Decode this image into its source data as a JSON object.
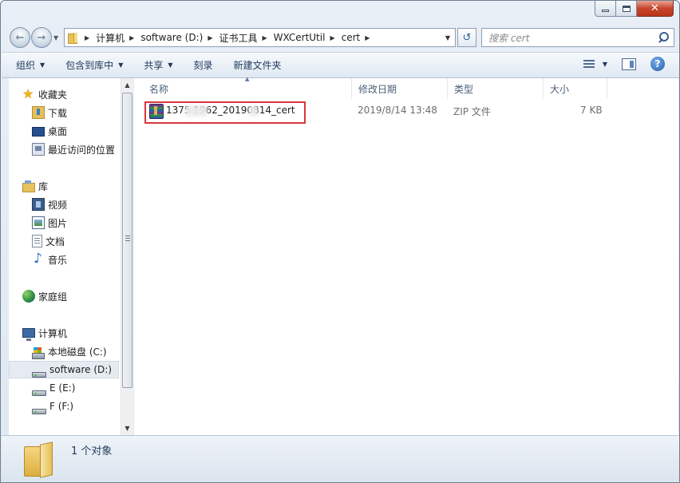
{
  "window": {
    "close_glyph": "✕"
  },
  "address_bar": {
    "breadcrumbs": [
      "计算机",
      "software (D:)",
      "证书工具",
      "WXCertUtil",
      "cert"
    ]
  },
  "search": {
    "placeholder": "搜索 cert"
  },
  "toolbar": {
    "organize": "组织",
    "include_in_library": "包含到库中",
    "share": "共享",
    "burn": "刻录",
    "new_folder": "新建文件夹"
  },
  "sidebar": {
    "favorites": "收藏夹",
    "downloads": "下载",
    "desktop": "桌面",
    "recent": "最近访问的位置",
    "libraries": "库",
    "videos": "视频",
    "pictures": "图片",
    "documents": "文档",
    "music": "音乐",
    "homegroup": "家庭组",
    "computer": "计算机",
    "drive_c": "本地磁盘 (C:)",
    "drive_d": "software (D:)",
    "drive_e": "E (E:)",
    "drive_f": "F (F:)"
  },
  "columns": {
    "name": "名称",
    "date_modified": "修改日期",
    "type": "类型",
    "size": "大小"
  },
  "files": [
    {
      "name": "137_______02_20190_14_cert",
      "name_display": "1375       1962_20190814_cert",
      "date_modified": "2019/8/14 13:48",
      "type": "ZIP 文件",
      "size": "7 KB"
    }
  ],
  "details": {
    "summary": "1 个对象"
  },
  "colors": {
    "highlight_border": "#d9363e",
    "toolbar_text": "#1e395b"
  }
}
